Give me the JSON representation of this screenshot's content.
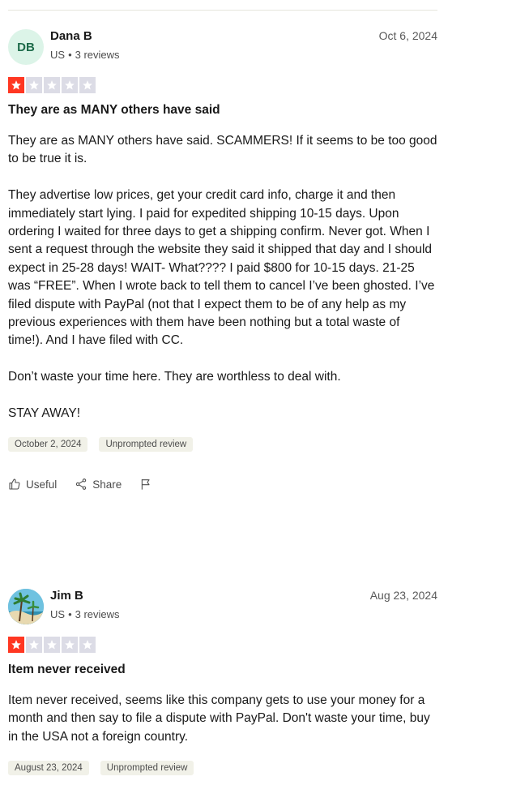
{
  "reviews": [
    {
      "initials": "DB",
      "name": "Dana B",
      "country": "US",
      "review_count": "3 reviews",
      "date": "Oct 6, 2024",
      "rating": 1,
      "title": "They are as MANY others have said",
      "paragraphs": [
        "They are as MANY others have said. SCAMMERS! If it seems to be too good to be true it is.",
        "They advertise low prices, get your credit card info, charge it and then immediately start lying. I paid for expedited shipping 10-15 days. Upon ordering I waited for three days to get a shipping confirm. Never got. When I sent a request through the website they said it shipped that day and I should expect in 25-28 days! WAIT- What???? I paid $800 for 10-15 days. 21-25 was “FREE”. When I wrote back to tell them to cancel I’ve been ghosted. I’ve filed dispute with PayPal (not that I expect them to be of any help as my previous experiences with them have been nothing but a total waste of time!). And I have filed with CC.",
        "Don’t waste your time here. They are worthless to deal with.",
        "STAY AWAY!"
      ],
      "experience_date": "October 2, 2024",
      "tag": "Unprompted review",
      "actions": {
        "useful": "Useful",
        "share": "Share"
      }
    },
    {
      "initials": "",
      "name": "Jim B",
      "country": "US",
      "review_count": "3 reviews",
      "date": "Aug 23, 2024",
      "rating": 1,
      "title": "Item never received",
      "paragraphs": [
        "Item never received, seems like this company gets to use your money for a month and then say to file a dispute with PayPal. Don't waste your time, buy in the USA not a foreign country."
      ],
      "experience_date": "August 23, 2024",
      "tag": "Unprompted review"
    }
  ],
  "colors": {
    "star_on": "#ff3722",
    "star_off": "#dcdce6",
    "tag_bg": "#f1f1e8"
  },
  "icons": [
    "star-icon",
    "thumbs-up-icon",
    "share-icon",
    "flag-icon"
  ]
}
